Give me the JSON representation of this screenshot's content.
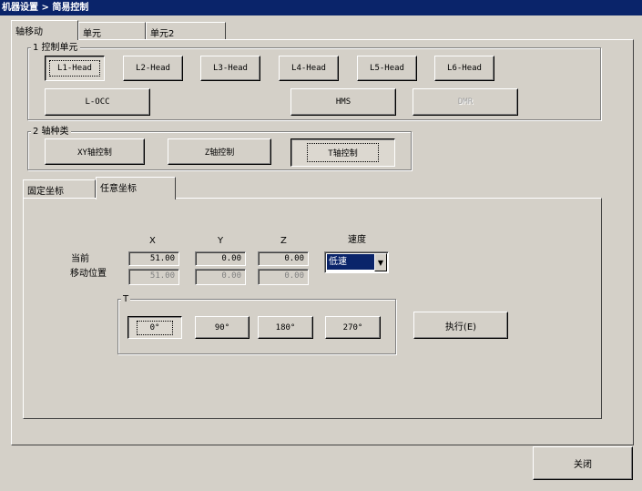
{
  "window": {
    "title": "机器设置 > 简易控制"
  },
  "main_tabs": [
    {
      "label": "轴移动",
      "active": true
    },
    {
      "label": "单元"
    },
    {
      "label": "单元2"
    }
  ],
  "group_control_unit": {
    "legend": "1  控制单元",
    "buttons": [
      "L1-Head",
      "L2-Head",
      "L3-Head",
      "L4-Head",
      "L5-Head",
      "L6-Head"
    ],
    "buttons_row2": [
      "L-OCC",
      "HMS",
      "DMR"
    ],
    "selected": "L1-Head",
    "disabled": [
      "DMR"
    ]
  },
  "group_axis": {
    "legend": "2  轴种类",
    "buttons": [
      "XY轴控制",
      "Z轴控制",
      "T轴控制"
    ],
    "selected": "T轴控制"
  },
  "coord_tabs": [
    {
      "label": "固定坐标"
    },
    {
      "label": "任意坐标",
      "active": true
    }
  ],
  "coords": {
    "headers": [
      "X",
      "Y",
      "Z"
    ],
    "speed_label": "速度",
    "row_current_label": "当前",
    "row_move_label": "移动位置",
    "current": [
      "51.00",
      "0.00",
      "0.00"
    ],
    "move": [
      "51.00",
      "0.00",
      "0.00"
    ],
    "speed_value": "低速"
  },
  "t_group": {
    "legend": "T",
    "buttons": [
      "0°",
      "90°",
      "180°",
      "270°"
    ],
    "selected": "0°"
  },
  "execute_label": "执行(E)",
  "close_label": "关闭"
}
